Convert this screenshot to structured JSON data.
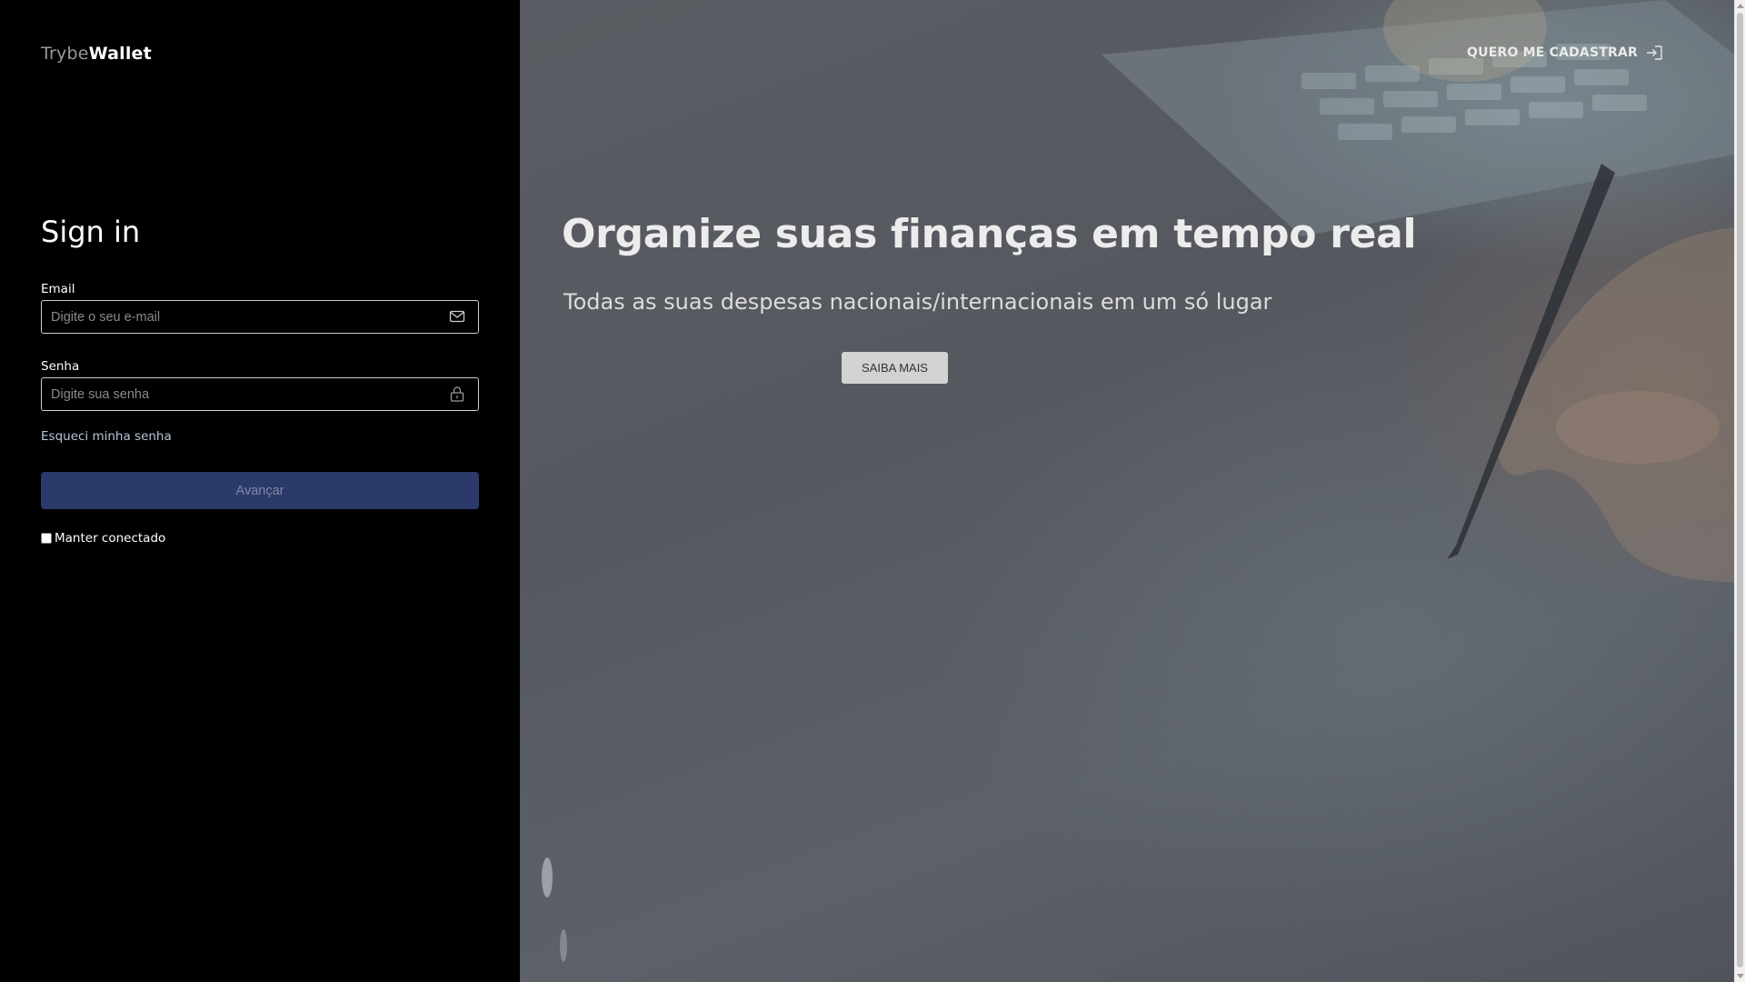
{
  "brand": {
    "light": "Trybe",
    "bold": "Wallet"
  },
  "login": {
    "title": "Sign in",
    "email_label": "Email",
    "email_placeholder": "Digite o seu e-mail",
    "email_value": "",
    "password_label": "Senha",
    "password_placeholder": "Digite sua senha",
    "password_value": "",
    "forgot_link": "Esqueci minha senha",
    "submit_label": "Avançar",
    "keep_connected_label": "Manter conectado",
    "keep_connected_checked": false
  },
  "hero": {
    "register_link": "QUERO ME CADASTRAR",
    "headline": "Organize suas finanças em tempo real",
    "subheadline": "Todas as suas despesas nacionais/internacionais em um só lugar",
    "cta_label": "SAIBA MAIS"
  },
  "icons": {
    "email": "mail-icon",
    "password": "lock-icon",
    "register": "login-arrow-icon"
  },
  "colors": {
    "left_bg": "#000000",
    "submit_bg": "#2b3a6b",
    "forgot_link": "#b7c6d8",
    "cta_bg": "#d2d2d2"
  }
}
